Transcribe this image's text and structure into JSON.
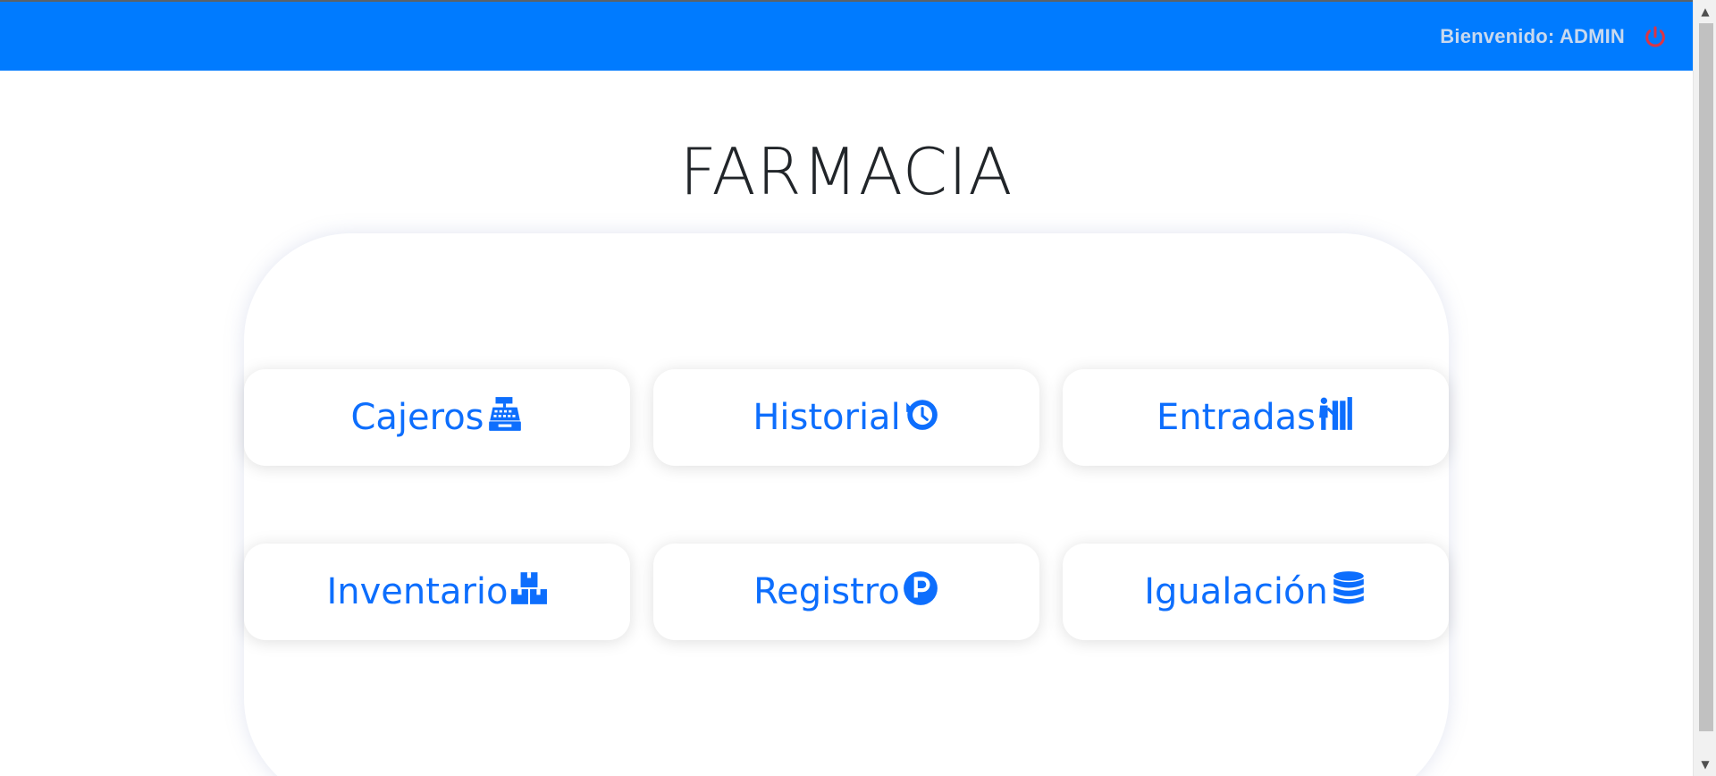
{
  "header": {
    "welcome_text": "Bienvenido: ADMIN",
    "logout_icon": "power-icon",
    "logout_color": "#dc3545",
    "bar_color": "#007bff"
  },
  "page": {
    "title": "FARMACIA"
  },
  "menu": [
    {
      "label": "Cajeros",
      "icon": "cash-register-icon"
    },
    {
      "label": "Historial",
      "icon": "history-icon"
    },
    {
      "label": "Entradas",
      "icon": "dolly-flatbed-icon"
    },
    {
      "label": "Inventario",
      "icon": "boxes-icon"
    },
    {
      "label": "Registro",
      "icon": "parking-circle-icon"
    },
    {
      "label": "Igualación",
      "icon": "database-icon"
    }
  ],
  "accent_color": "#0d6efd"
}
